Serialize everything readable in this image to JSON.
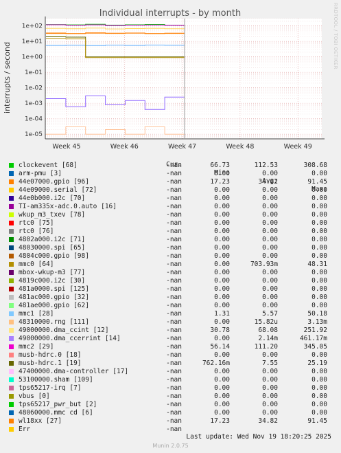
{
  "title": "Individual interrupts - by month",
  "side_label": "RRDTOOL / TOBI OETIKER",
  "footer": "Munin 2.0.75",
  "last_update": "Last update: Wed Nov 19 18:20:25 2025",
  "legend_headers": {
    "cur": "Cur:",
    "min": "Min:",
    "avg": "Avg:",
    "max": "Max:"
  },
  "chart_data": {
    "type": "line",
    "title": "Individual interrupts - by month",
    "ylabel": "interrupts / second",
    "yscale": "log",
    "ylim": [
      5e-06,
      300
    ],
    "y_ticks": [
      "1e+02",
      "1e+01",
      "1e+00",
      "1e-01",
      "1e-02",
      "1e-03",
      "1e-04",
      "1e-05"
    ],
    "x_ticks": [
      "Week 45",
      "Week 46",
      "Week 47",
      "Week 48",
      "Week 49"
    ],
    "grid": true,
    "series": [
      {
        "name": "clockevent [68]",
        "color": "#00cc00",
        "values": [
          125,
          118,
          130,
          112,
          120,
          126,
          110
        ]
      },
      {
        "name": "mmc2 [29]",
        "color": "#cc00cc",
        "values": [
          120,
          110,
          118,
          105,
          112,
          115,
          108
        ]
      },
      {
        "name": "wl18xx [27]",
        "color": "#ff8000",
        "values": [
          35,
          33,
          36,
          34,
          35,
          33,
          34
        ]
      },
      {
        "name": "44e07000.gpio [96]",
        "color": "#ff7f00",
        "values": [
          33,
          32,
          34,
          33,
          34,
          32,
          33
        ]
      },
      {
        "name": "49000000.dma_ccint [12]",
        "color": "#ffd966",
        "values": [
          70,
          66,
          72,
          64,
          68,
          70,
          66
        ]
      },
      {
        "name": "mmc1 [28]",
        "color": "#66b2ff",
        "values": [
          5.5,
          5.6,
          5.4,
          5.7,
          5.5,
          5.8,
          5.6
        ]
      },
      {
        "name": "musb-hdrc.1 [19]",
        "color": "#666600",
        "values": [
          20,
          19,
          1,
          1,
          1,
          1,
          1
        ]
      },
      {
        "name": "mmc0 [64]",
        "color": "#b38f00",
        "values": [
          15,
          14.5,
          0.9,
          0.9,
          0.9,
          0.9,
          0.9
        ]
      },
      {
        "name": "49000000.dma_ccerrint [14]",
        "color": "#8f66ff",
        "values": [
          0.002,
          0.0006,
          0.003,
          0.0008,
          0.0015,
          0.0004,
          0.0025
        ]
      },
      {
        "name": "48310000.rng [111]",
        "color": "#ffc299",
        "values": [
          1e-05,
          3e-05,
          1e-05,
          2e-05,
          1e-05,
          3e-05,
          1e-05
        ]
      }
    ]
  },
  "legend": [
    {
      "name": "clockevent [68]",
      "color": "#00cc00",
      "cur": "-nan",
      "min": "66.73",
      "avg": "112.53",
      "max": "308.68"
    },
    {
      "name": "arm-pmu [3]",
      "color": "#0066b3",
      "cur": "-nan",
      "min": "0.00",
      "avg": "0.00",
      "max": "0.00"
    },
    {
      "name": "44e07000.gpio [96]",
      "color": "#ff8000",
      "cur": "-nan",
      "min": "17.23",
      "avg": "34.82",
      "max": "91.45"
    },
    {
      "name": "44e09000.serial [72]",
      "color": "#ffcc00",
      "cur": "-nan",
      "min": "0.00",
      "avg": "0.00",
      "max": "0.00"
    },
    {
      "name": "44e0b000.i2c [70]",
      "color": "#330099",
      "cur": "-nan",
      "min": "0.00",
      "avg": "0.00",
      "max": "0.00"
    },
    {
      "name": "TI-am335x-adc.0.auto [16]",
      "color": "#990099",
      "cur": "-nan",
      "min": "0.00",
      "avg": "0.00",
      "max": "0.00"
    },
    {
      "name": "wkup_m3_txev [78]",
      "color": "#ccff00",
      "cur": "-nan",
      "min": "0.00",
      "avg": "0.00",
      "max": "0.00"
    },
    {
      "name": "rtc0 [75]",
      "color": "#ff0000",
      "cur": "-nan",
      "min": "0.00",
      "avg": "0.00",
      "max": "0.00"
    },
    {
      "name": "rtc0 [76]",
      "color": "#808080",
      "cur": "-nan",
      "min": "0.00",
      "avg": "0.00",
      "max": "0.00"
    },
    {
      "name": "4802a000.i2c [71]",
      "color": "#008f00",
      "cur": "-nan",
      "min": "0.00",
      "avg": "0.00",
      "max": "0.00"
    },
    {
      "name": "48030000.spi [65]",
      "color": "#00487d",
      "cur": "-nan",
      "min": "0.00",
      "avg": "0.00",
      "max": "0.00"
    },
    {
      "name": "4804c000.gpio [98]",
      "color": "#b35a00",
      "cur": "-nan",
      "min": "0.00",
      "avg": "0.00",
      "max": "0.00"
    },
    {
      "name": "mmc0 [64]",
      "color": "#b38f00",
      "cur": "-nan",
      "min": "0.00",
      "avg": "703.93m",
      "max": "48.31"
    },
    {
      "name": "mbox-wkup-m3 [77]",
      "color": "#6b006b",
      "cur": "-nan",
      "min": "0.00",
      "avg": "0.00",
      "max": "0.00"
    },
    {
      "name": "4819c000.i2c [30]",
      "color": "#8fb300",
      "cur": "-nan",
      "min": "0.00",
      "avg": "0.00",
      "max": "0.00"
    },
    {
      "name": "481a0000.spi [125]",
      "color": "#b30000",
      "cur": "-nan",
      "min": "0.00",
      "avg": "0.00",
      "max": "0.00"
    },
    {
      "name": "481ac000.gpio [32]",
      "color": "#bebebe",
      "cur": "-nan",
      "min": "0.00",
      "avg": "0.00",
      "max": "0.00"
    },
    {
      "name": "481ae000.gpio [62]",
      "color": "#80ff80",
      "cur": "-nan",
      "min": "0.00",
      "avg": "0.00",
      "max": "0.00"
    },
    {
      "name": "mmc1 [28]",
      "color": "#80c9ff",
      "cur": "-nan",
      "min": "1.31",
      "avg": "5.57",
      "max": "50.18"
    },
    {
      "name": "48310000.rng [111]",
      "color": "#ffc080",
      "cur": "-nan",
      "min": "0.00",
      "avg": "15.82u",
      "max": "3.13m"
    },
    {
      "name": "49000000.dma_ccint [12]",
      "color": "#ffe680",
      "cur": "-nan",
      "min": "30.78",
      "avg": "68.08",
      "max": "251.92"
    },
    {
      "name": "49000000.dma_ccerrint [14]",
      "color": "#aa80ff",
      "cur": "-nan",
      "min": "0.00",
      "avg": "2.14m",
      "max": "461.17m"
    },
    {
      "name": "mmc2 [29]",
      "color": "#ee00cc",
      "cur": "-nan",
      "min": "56.14",
      "avg": "111.20",
      "max": "345.05"
    },
    {
      "name": "musb-hdrc.0 [18]",
      "color": "#ff8080",
      "cur": "-nan",
      "min": "0.00",
      "avg": "0.00",
      "max": "0.00"
    },
    {
      "name": "musb-hdrc.1 [19]",
      "color": "#666600",
      "cur": "-nan",
      "min": "762.16m",
      "avg": "7.55",
      "max": "25.19"
    },
    {
      "name": "47400000.dma-controller [17]",
      "color": "#ffbfff",
      "cur": "-nan",
      "min": "0.00",
      "avg": "0.00",
      "max": "0.00"
    },
    {
      "name": "53100000.sham [109]",
      "color": "#00ffcc",
      "cur": "-nan",
      "min": "0.00",
      "avg": "0.00",
      "max": "0.00"
    },
    {
      "name": "tps65217-irq [7]",
      "color": "#cc6699",
      "cur": "-nan",
      "min": "0.00",
      "avg": "0.00",
      "max": "0.00"
    },
    {
      "name": "vbus [0]",
      "color": "#999900",
      "cur": "-nan",
      "min": "0.00",
      "avg": "0.00",
      "max": "0.00"
    },
    {
      "name": "tps65217_pwr_but [2]",
      "color": "#00cc00",
      "cur": "-nan",
      "min": "0.00",
      "avg": "0.00",
      "max": "0.00"
    },
    {
      "name": "48060000.mmc cd [6]",
      "color": "#0066b3",
      "cur": "-nan",
      "min": "0.00",
      "avg": "0.00",
      "max": "0.00"
    },
    {
      "name": "wl18xx [27]",
      "color": "#ff8000",
      "cur": "-nan",
      "min": "17.23",
      "avg": "34.82",
      "max": "91.45"
    },
    {
      "name": "Err",
      "color": "#ffcc00",
      "cur": "-nan",
      "min": "",
      "avg": "",
      "max": ""
    }
  ]
}
